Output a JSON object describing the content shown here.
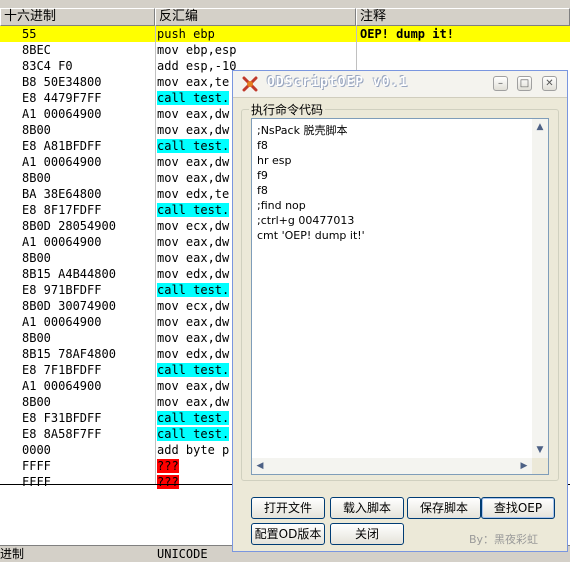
{
  "disasm": {
    "headers": {
      "hex": "十六进制",
      "disasm": "反汇编",
      "comment": "注释"
    },
    "rows": [
      {
        "hex": "55",
        "dis": "push ebp",
        "cmt": "OEP! dump it!",
        "kind": ""
      },
      {
        "hex": "8BEC",
        "dis": "mov ebp,esp",
        "cmt": "",
        "kind": ""
      },
      {
        "hex": "83C4 F0",
        "dis": "add esp,-10",
        "cmt": "",
        "kind": ""
      },
      {
        "hex": "B8 50E34800",
        "dis": "mov eax,te",
        "cmt": "",
        "kind": ""
      },
      {
        "hex": "E8 4479F7FF",
        "dis": "call test.",
        "cmt": "",
        "kind": "call"
      },
      {
        "hex": "A1 00064900",
        "dis": "mov eax,dw",
        "cmt": "",
        "kind": ""
      },
      {
        "hex": "8B00",
        "dis": "mov eax,dw",
        "cmt": "",
        "kind": ""
      },
      {
        "hex": "E8 A81BFDFF",
        "dis": "call test.",
        "cmt": "",
        "kind": "call"
      },
      {
        "hex": "A1 00064900",
        "dis": "mov eax,dw",
        "cmt": "",
        "kind": ""
      },
      {
        "hex": "8B00",
        "dis": "mov eax,dw",
        "cmt": "",
        "kind": ""
      },
      {
        "hex": "BA 38E64800",
        "dis": "mov edx,te",
        "cmt": "",
        "kind": ""
      },
      {
        "hex": "E8 8F17FDFF",
        "dis": "call test.",
        "cmt": "",
        "kind": "call"
      },
      {
        "hex": "8B0D 28054900",
        "dis": "mov ecx,dw",
        "cmt": "",
        "kind": ""
      },
      {
        "hex": "A1 00064900",
        "dis": "mov eax,dw",
        "cmt": "",
        "kind": ""
      },
      {
        "hex": "8B00",
        "dis": "mov eax,dw",
        "cmt": "",
        "kind": ""
      },
      {
        "hex": "8B15 A4B44800",
        "dis": "mov edx,dw",
        "cmt": "",
        "kind": ""
      },
      {
        "hex": "E8 971BFDFF",
        "dis": "call test.",
        "cmt": "",
        "kind": "call"
      },
      {
        "hex": "8B0D 30074900",
        "dis": "mov ecx,dw",
        "cmt": "",
        "kind": ""
      },
      {
        "hex": "A1 00064900",
        "dis": "mov eax,dw",
        "cmt": "",
        "kind": ""
      },
      {
        "hex": "8B00",
        "dis": "mov eax,dw",
        "cmt": "",
        "kind": ""
      },
      {
        "hex": "8B15 78AF4800",
        "dis": "mov edx,dw",
        "cmt": "",
        "kind": ""
      },
      {
        "hex": "E8 7F1BFDFF",
        "dis": "call test.",
        "cmt": "",
        "kind": "call"
      },
      {
        "hex": "A1 00064900",
        "dis": "mov eax,dw",
        "cmt": "",
        "kind": ""
      },
      {
        "hex": "8B00",
        "dis": "mov eax,dw",
        "cmt": "",
        "kind": ""
      },
      {
        "hex": "E8 F31BFDFF",
        "dis": "call test.",
        "cmt": "",
        "kind": "call"
      },
      {
        "hex": "E8 8A58F7FF",
        "dis": "call test.",
        "cmt": "",
        "kind": "call"
      },
      {
        "hex": "0000",
        "dis": "add byte p",
        "cmt": "",
        "kind": ""
      },
      {
        "hex": "FFFF",
        "dis": "???",
        "cmt": "",
        "kind": "bad"
      },
      {
        "hex": "FFFF",
        "dis": "???",
        "cmt": "",
        "kind": "bad"
      }
    ]
  },
  "statusbar": {
    "left": "进制",
    "right": "UNICODE"
  },
  "dialog": {
    "title": "ODScriptOEP  v0.1",
    "group_label": "执行命令代码",
    "code_lines": [
      ";NsPack 脱壳脚本",
      "f8",
      "hr esp",
      "f9",
      "f8",
      ";find nop",
      ";ctrl+g 00477013",
      "cmt 'OEP! dump it!'"
    ],
    "buttons": {
      "open_file": "打开文件",
      "load_script": "载入脚本",
      "save_script": "保存脚本",
      "find_oep": "查找OEP",
      "config_od": "配置OD版本",
      "close": "关闭"
    },
    "credit": "By：黑夜彩虹"
  },
  "colors": {
    "selection": "#ffff00",
    "call_highlight": "#00ffff",
    "bad_highlight": "#ff0000"
  }
}
